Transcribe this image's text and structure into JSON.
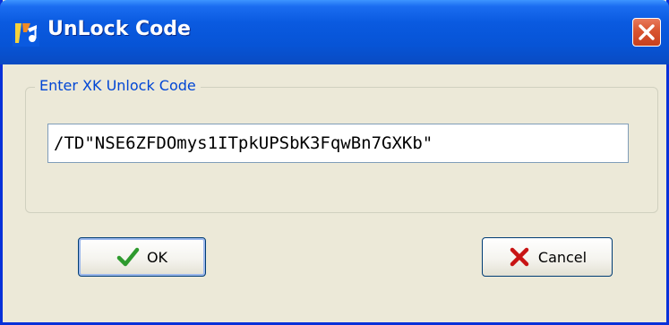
{
  "window": {
    "title": "UnLock Code",
    "icons": {
      "app": "music-note-app-icon",
      "close": "close-icon"
    },
    "colors": {
      "titlebar": "#0754d6",
      "close": "#d8542f",
      "legend": "#0046d5",
      "face": "#ece9d8"
    }
  },
  "group": {
    "label": "Enter XK Unlock Code"
  },
  "input": {
    "value": "/TD\"NSE6ZFDOmys1ITpkUPSbK3FqwBn7GXKb\""
  },
  "buttons": {
    "ok": {
      "label": "OK",
      "icon": "check-icon"
    },
    "cancel": {
      "label": "Cancel",
      "icon": "x-mark-icon"
    }
  }
}
